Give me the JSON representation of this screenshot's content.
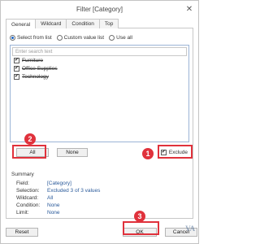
{
  "window": {
    "title": "Filter [Category]",
    "close_glyph": "✕"
  },
  "tabs": [
    {
      "label": "General",
      "active": true
    },
    {
      "label": "Wildcard",
      "active": false
    },
    {
      "label": "Condition",
      "active": false
    },
    {
      "label": "Top",
      "active": false
    }
  ],
  "radios": [
    {
      "label": "Select from list",
      "selected": true
    },
    {
      "label": "Custom value list",
      "selected": false
    },
    {
      "label": "Use all",
      "selected": false
    }
  ],
  "search": {
    "placeholder": "Enter search text"
  },
  "items": [
    {
      "label": "Furniture",
      "checked": true
    },
    {
      "label": "Office Supplies",
      "checked": true
    },
    {
      "label": "Technology",
      "checked": true
    }
  ],
  "buttons": {
    "all": "All",
    "none": "None",
    "reset": "Reset",
    "ok": "OK",
    "cancel": "Cancel"
  },
  "exclude": {
    "label": "Exclude",
    "checked": true
  },
  "summary": {
    "title": "Summary",
    "rows": [
      {
        "key": "Field:",
        "value": "[Category]"
      },
      {
        "key": "Selection:",
        "value": "Excluded 3 of 3 values"
      },
      {
        "key": "Wildcard:",
        "value": "All"
      },
      {
        "key": "Condition:",
        "value": "None"
      },
      {
        "key": "Limit:",
        "value": "None"
      }
    ]
  },
  "callouts": {
    "one": "1",
    "two": "2",
    "three": "3"
  },
  "colors": {
    "accent": "#e0323c",
    "selected": "#1a66c8",
    "summary_value": "#2a5a9a"
  }
}
